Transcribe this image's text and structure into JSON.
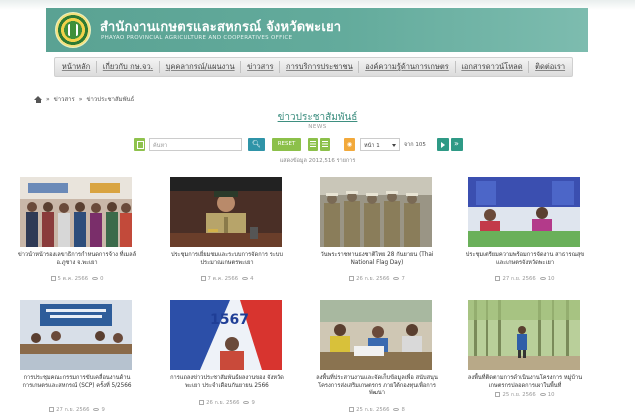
{
  "header": {
    "office_th": "สำนักงานเกษตรและสหกรณ์ จังหวัดพะเยา",
    "office_en": "PHAYAO PROVINCIAL AGRICULTURE AND COOPERATIVES OFFICE"
  },
  "nav": {
    "items": [
      "หน้าหลัก",
      "เกี่ยวกับ กษ.จว.",
      "บุคคลากรณ์/แผนงาน",
      "ข่าวสาร",
      "การบริการประชาชน",
      "องค์ความรู้ด้านการเกษตร",
      "เอกสารดาวน์โหลด",
      "ติดต่อเรา"
    ]
  },
  "breadcrumb": [
    "ข่าวสาร",
    "ข่าวประชาสัมพันธ์"
  ],
  "section": {
    "title": "ข่าวประชาสัมพันธ์",
    "subtitle": "NEWS"
  },
  "toolbar": {
    "search_placeholder": "ค้นหา",
    "reset_label": "RESET",
    "page_select": "หน้า 1",
    "of_label": "จาก 105"
  },
  "total_text": "แสดงข้อมูล 2012,516 รายการ",
  "cards": [
    {
      "caption": "ข่าวนำหน้ารองเลขาธิการกำหนดการจ้าง ที่เมลล์ อ.ภูซาง จ.พะเยา",
      "date": "5 ต.ค. 2566",
      "views": "0",
      "palette": "people"
    },
    {
      "caption": "ประชุมการเยี่ยมชมและระบบการจัดการ ระบบประมาณเกษตรพะเยา",
      "date": "7 ต.ค. 2566",
      "views": "4",
      "palette": "officer"
    },
    {
      "caption": "วันพระราชทานธงชาติไทย 28 กันยายน (Thai National Flag Day)",
      "date": "26 ก.ย. 2566",
      "views": "7",
      "palette": "salute"
    },
    {
      "caption": "ประชุมเตรียมความพร้อมการจัดงาน สาธารณสุขและเกษตรจังหวัดพะเยา",
      "date": "27 ก.ย. 2566",
      "views": "10",
      "palette": "desk"
    },
    {
      "caption": "การประชุมคณะกรรมการขับเคลื่อนงานด้าน การเกษตรและสหกรณ์ (SCP) ครั้งที่ 5/2566",
      "date": "27 ก.ย. 2566",
      "views": "9",
      "palette": "meeting"
    },
    {
      "caption": "การแถลงข่าวประชาสัมพันธ์ผลงานของ จังหวัดพะเยา ประจำเดือนกันยายน 2566",
      "date": "26 ก.ย. 2566",
      "views": "9",
      "palette": "studio"
    },
    {
      "caption": "ลงพื้นที่ประสานงานและจัดเก็บข้อมูลเพื่อ สนับสนุนโครงการส่งเสริมเกษตรกร ภายใต้กองทุนเพื่อการพัฒนา",
      "date": "25 ก.ย. 2566",
      "views": "8",
      "palette": "field"
    },
    {
      "caption": "ลงพื้นที่ติดตามการดำเนินงานโครงการ หมู่บ้านเกษตรกรปลอดการเผาในพื้นที่",
      "date": "25 ก.ย. 2566",
      "views": "10",
      "palette": "forest"
    }
  ]
}
